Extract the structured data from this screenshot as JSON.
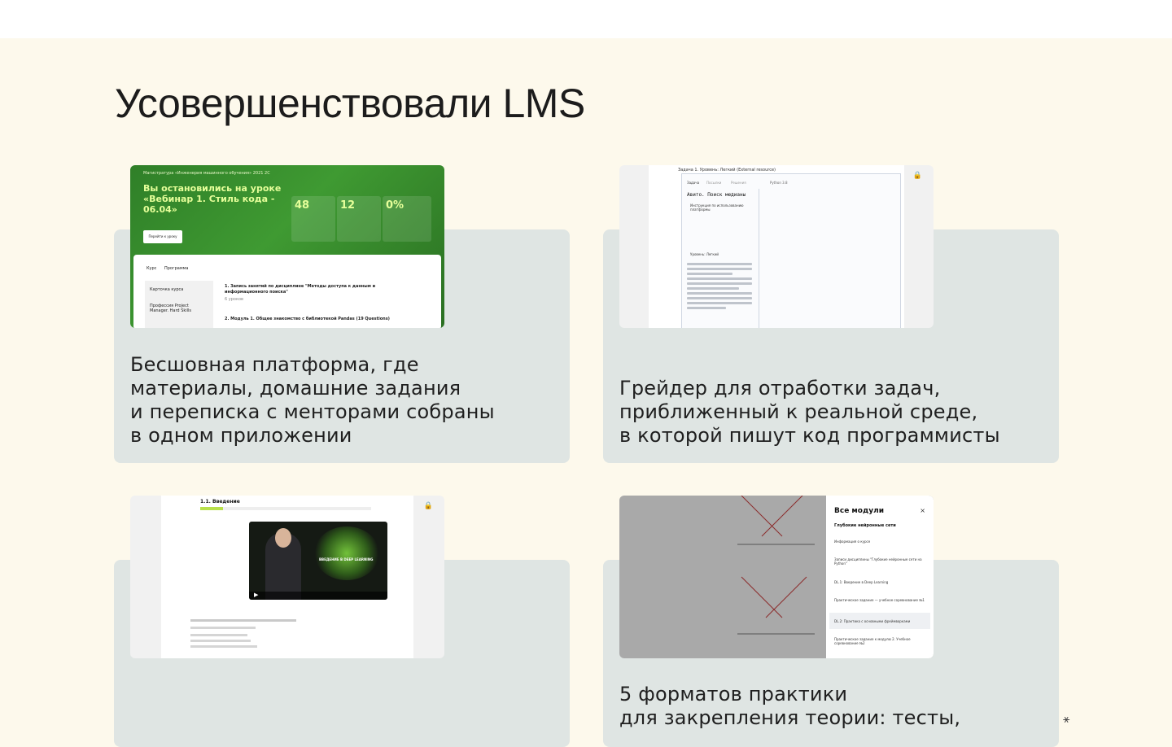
{
  "section": {
    "title": "Усовершенствовали LMS"
  },
  "cards": [
    {
      "text": "Бесшовная платформа, где\nматериалы, домашние задания\nи переписка с менторами собраны\nв одном приложении"
    },
    {
      "text": "Грейдер для отработки задач,\nприближенный к реальной среде,\nв которой пишут код программисты"
    },
    {
      "text": ""
    },
    {
      "text": "5 форматов практики\nдля закрепления теории: тесты,"
    }
  ],
  "shot1": {
    "program": "Магистратура «Инженерия машинного обучения» 2021 2С",
    "headline": "Вы остановились на уроке\n«Вебинар 1. Стиль кода -\n06.04»",
    "button": "Перейти к уроку",
    "stats": [
      "48",
      "12",
      "0%"
    ],
    "tabs": [
      "Курс",
      "Программа"
    ],
    "side_items": [
      "Карточка курса",
      "Профессия Project Manager. Hard Skills"
    ],
    "lines": [
      "1. Запись занятий по дисциплине \"Методы доступа к данным и",
      "информационного поиска\"",
      "6 уроков",
      "2. Модуль 1. Общее знакомство с библиотекой Pandas (19 Questions)"
    ]
  },
  "shot2": {
    "task": "Задача 1. Уровень: Легкий (External resource)",
    "panel_title": "Авито. Поиск медианы",
    "tabs": [
      "Задача",
      "Посылки",
      "Решения"
    ],
    "language": "Python 3.8",
    "instruction": "Инструкция по использованию платформы",
    "level": "Уровень: Легкий"
  },
  "shot3": {
    "title": "1.1. Введение",
    "video_caption": "ВВЕДЕНИЕ В DEEP LEARNING"
  },
  "shot4": {
    "modal_title": "Все модули",
    "modal_sub": "Глубокие нейронные сети",
    "items": [
      "Информация о курсе",
      "Записи дисциплины \"Глубокие нейронные сети на Python\"",
      "DL.1: Введение в Deep Learning",
      "Практическое задание — учебное соревнование №1",
      "DL.2: Практика с основными фреймворками",
      "Практическое задание к модулю 2. Учебное соревнование №2"
    ]
  }
}
